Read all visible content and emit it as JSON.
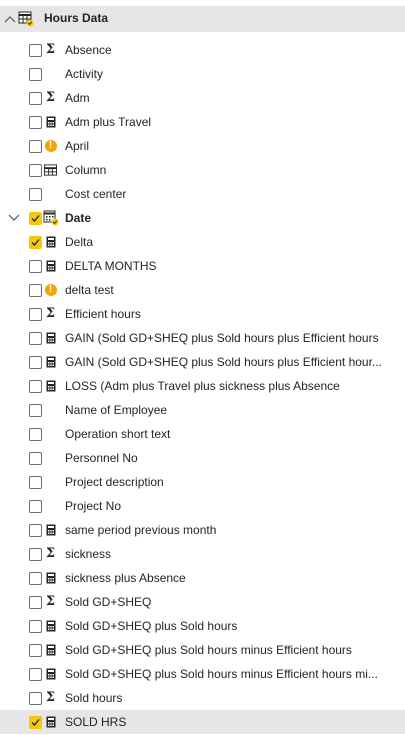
{
  "table": {
    "title": "Hours Data",
    "icon": "table-icon",
    "expanded": true
  },
  "date_group": {
    "label": "Date",
    "icon": "date-hierarchy-icon",
    "checked": true,
    "expanded": true
  },
  "fields": [
    {
      "label": "Absence",
      "icon": "sigma-icon",
      "checked": false
    },
    {
      "label": "Activity",
      "icon": "none",
      "checked": false
    },
    {
      "label": "Adm",
      "icon": "sigma-icon",
      "checked": false
    },
    {
      "label": "Adm plus Travel",
      "icon": "calculator-icon",
      "checked": false
    },
    {
      "label": "April",
      "icon": "warning-icon",
      "checked": false
    },
    {
      "label": "Column",
      "icon": "column-icon",
      "checked": false
    },
    {
      "label": "Cost center",
      "icon": "none",
      "checked": false
    },
    {
      "label": "Date",
      "icon": "date-hierarchy-icon",
      "checked": true,
      "group": true
    },
    {
      "label": "Delta",
      "icon": "calculator-icon",
      "checked": true
    },
    {
      "label": "DELTA MONTHS",
      "icon": "calculator-icon",
      "checked": false
    },
    {
      "label": "delta test",
      "icon": "warning-icon",
      "checked": false
    },
    {
      "label": "Efficient hours",
      "icon": "sigma-icon",
      "checked": false
    },
    {
      "label": "GAIN (Sold GD+SHEQ plus Sold hours plus Efficient hours",
      "icon": "calculator-icon",
      "checked": false
    },
    {
      "label": "GAIN (Sold GD+SHEQ plus Sold hours plus Efficient hour...",
      "icon": "calculator-icon",
      "checked": false
    },
    {
      "label": "LOSS (Adm plus Travel plus sickness plus Absence",
      "icon": "calculator-icon",
      "checked": false
    },
    {
      "label": "Name of Employee",
      "icon": "none",
      "checked": false
    },
    {
      "label": "Operation short text",
      "icon": "none",
      "checked": false
    },
    {
      "label": "Personnel No",
      "icon": "none",
      "checked": false
    },
    {
      "label": "Project description",
      "icon": "none",
      "checked": false
    },
    {
      "label": "Project No",
      "icon": "none",
      "checked": false
    },
    {
      "label": "same period previous month",
      "icon": "calculator-icon",
      "checked": false
    },
    {
      "label": "sickness",
      "icon": "sigma-icon",
      "checked": false
    },
    {
      "label": "sickness plus Absence",
      "icon": "calculator-icon",
      "checked": false
    },
    {
      "label": "Sold GD+SHEQ",
      "icon": "sigma-icon",
      "checked": false
    },
    {
      "label": "Sold GD+SHEQ plus Sold hours",
      "icon": "calculator-icon",
      "checked": false
    },
    {
      "label": "Sold GD+SHEQ plus Sold hours minus Efficient hours",
      "icon": "calculator-icon",
      "checked": false
    },
    {
      "label": "Sold GD+SHEQ plus Sold hours minus Efficient hours mi...",
      "icon": "calculator-icon",
      "checked": false
    },
    {
      "label": "Sold hours",
      "icon": "sigma-icon",
      "checked": false
    },
    {
      "label": "SOLD HRS",
      "icon": "calculator-icon",
      "checked": true,
      "selected": true
    }
  ],
  "colors": {
    "accent": "#f2c811",
    "warning": "#f2a60c",
    "header_bg": "#e6e6e6",
    "text": "#252423"
  }
}
